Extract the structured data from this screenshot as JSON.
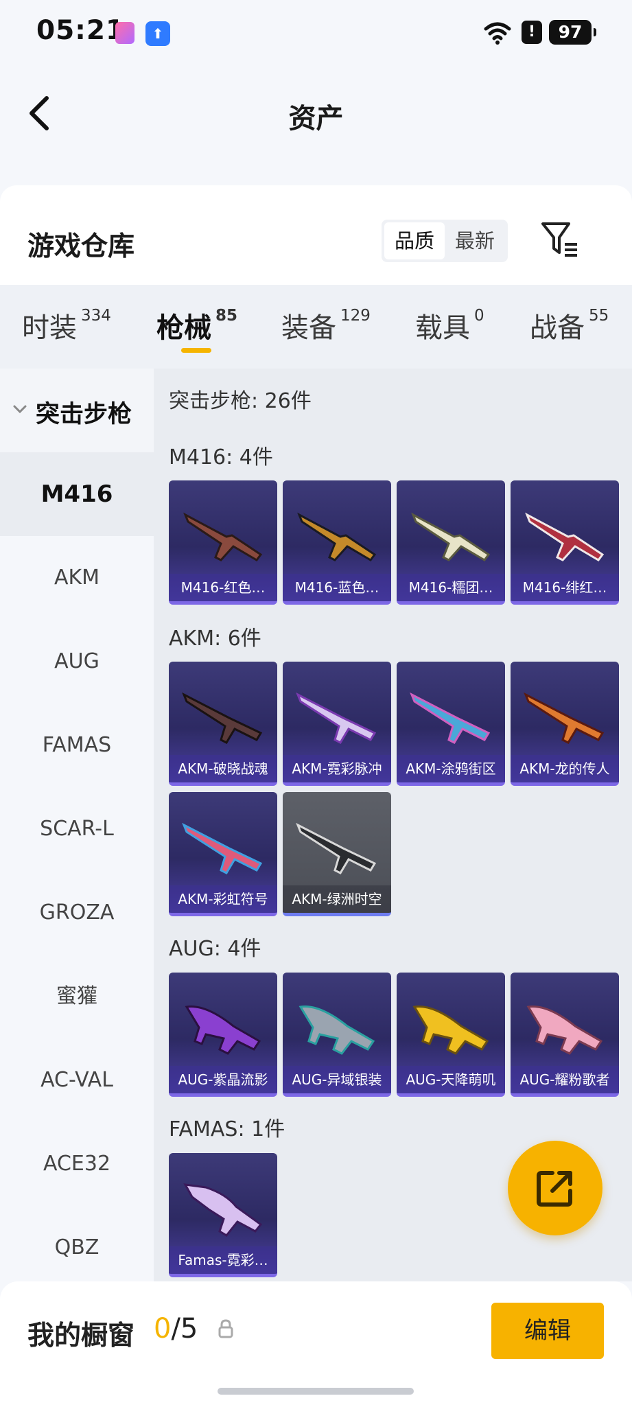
{
  "status_bar": {
    "time": "05:21",
    "battery": "97",
    "alert": "!"
  },
  "header": {
    "title": "资产",
    "back_icon": "chevron-left-icon"
  },
  "section": {
    "title": "游戏仓库",
    "sort_options": [
      "品质",
      "最新"
    ],
    "sort_selected": "品质",
    "filter_icon": "filter-icon"
  },
  "tabs": [
    {
      "label": "时装",
      "count": "334"
    },
    {
      "label": "枪械",
      "count": "85"
    },
    {
      "label": "装备",
      "count": "129"
    },
    {
      "label": "载具",
      "count": "0"
    },
    {
      "label": "战备",
      "count": "55"
    }
  ],
  "tab_selected": "枪械",
  "sidebar": {
    "group": "突击步枪",
    "items": [
      "M416",
      "AKM",
      "AUG",
      "FAMAS",
      "SCAR-L",
      "GROZA",
      "蜜獾",
      "AC-VAL",
      "ACE32",
      "QBZ"
    ],
    "selected": "M416"
  },
  "content": {
    "summary": "突击步枪: 26件",
    "groups": [
      {
        "title": "M416: 4件",
        "items": [
          "M416-红色…",
          "M416-蓝色…",
          "M416-糯团…",
          "M416-绯红…"
        ]
      },
      {
        "title": "AKM: 6件",
        "items": [
          "AKM-破晓战魂",
          "AKM-霓彩脉冲",
          "AKM-涂鸦街区",
          "AKM-龙的传人",
          "AKM-彩虹符号",
          "AKM-绿洲时空"
        ]
      },
      {
        "title": "AUG: 4件",
        "items": [
          "AUG-紫晶流影",
          "AUG-异域银装",
          "AUG-天降萌叽",
          "AUG-耀粉歌者"
        ]
      },
      {
        "title": "FAMAS: 1件",
        "items": [
          "Famas-霓彩…"
        ]
      }
    ]
  },
  "fab": {
    "icon": "share-external-icon"
  },
  "bottom": {
    "title": "我的橱窗",
    "current": "0",
    "total": "/5",
    "lock_icon": "lock-icon",
    "edit_label": "编辑"
  },
  "colors": {
    "accent": "#f7b200",
    "card": "#3d3a78",
    "card_border": "#7d68e6"
  }
}
